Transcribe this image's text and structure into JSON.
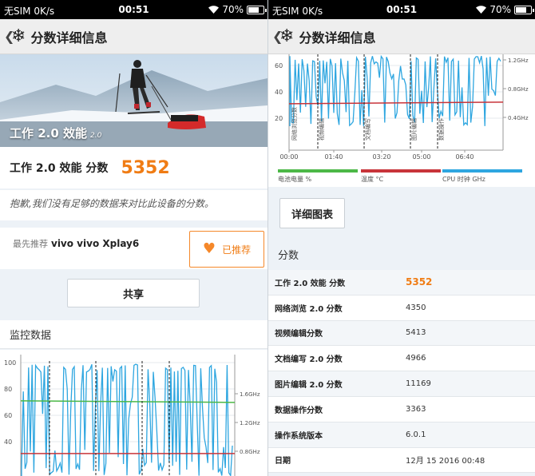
{
  "status": {
    "carrier": "无SIM",
    "speed": "0K/s",
    "time": "00:51",
    "battery": "70%",
    "wifi_icon": "wifi-icon"
  },
  "header": {
    "title": "分数详细信息",
    "back_glyph": "❮",
    "logo_icon": "snowflake-icon"
  },
  "benchmark": {
    "name": "工作 2.0 效能",
    "version": "2.0",
    "score_label": "工作 2.0 效能 分数",
    "score": "5352"
  },
  "notice": "抱歉,我们没有足够的数据来对比此设备的分数。",
  "recommend": {
    "prefix": "最先推荐",
    "device": "vivo vivo Xplay6",
    "button": "已推荐"
  },
  "share_button": "共享",
  "monitor": {
    "title": "监控数据"
  },
  "chart_data": {
    "type": "line",
    "x_ticks": [
      "00:00",
      "01:40",
      "03:20",
      "05:00",
      "06:40"
    ],
    "y_ticks_left": [
      20,
      40,
      60,
      80,
      100
    ],
    "y_ticks_right": [
      "0.4GHz",
      "0.8GHz",
      "1.2GHz",
      "1.6GHz"
    ],
    "segments": [
      "网络浏览分数",
      "视频编辑",
      "文档编写",
      "图片编辑",
      "数据操作"
    ],
    "series": [
      {
        "name": "电池电量 %",
        "color": "#4cb847",
        "level": 71
      },
      {
        "name": "温度 °C",
        "color": "#c8343a",
        "level": 31
      },
      {
        "name": "CPU 时钟 GHz",
        "color": "#2ea6e0"
      }
    ]
  },
  "detail_button": "详细图表",
  "scores": {
    "title": "分数",
    "rows": [
      {
        "label": "工作 2.0 效能 分数",
        "value": "5352"
      },
      {
        "label": "网络浏览 2.0 分数",
        "value": "4350"
      },
      {
        "label": "视频编辑分数",
        "value": "5413"
      },
      {
        "label": "文档编写 2.0 分数",
        "value": "4966"
      },
      {
        "label": "图片编辑 2.0 分数",
        "value": "11169"
      },
      {
        "label": "数据操作分数",
        "value": "3363"
      },
      {
        "label": "操作系统版本",
        "value": "6.0.1"
      },
      {
        "label": "日期",
        "value": "12月 15 2016 00:48"
      }
    ]
  }
}
